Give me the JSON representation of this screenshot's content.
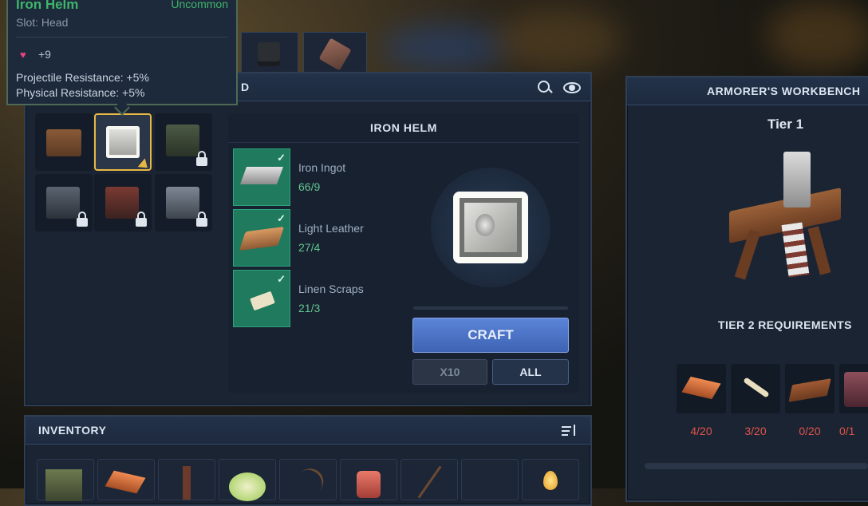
{
  "tooltip": {
    "name": "Iron Helm",
    "rarity": "Uncommon",
    "slot": "Slot: Head",
    "health_bonus": "+9",
    "stats": [
      "Projectile Resistance: +5%",
      "Physical Resistance: +5%"
    ]
  },
  "crafting": {
    "header_fragment": "D",
    "item_title": "IRON HELM",
    "materials": [
      {
        "name": "Iron Ingot",
        "count": "66/9"
      },
      {
        "name": "Light Leather",
        "count": "27/4"
      },
      {
        "name": "Linen Scraps",
        "count": "21/3"
      }
    ],
    "craft_label": "CRAFT",
    "x10_label": "X10",
    "all_label": "ALL"
  },
  "workbench": {
    "title": "ARMORER'S WORKBENCH",
    "tier": "Tier 1",
    "requirements_title": "TIER 2 REQUIREMENTS",
    "requirements": [
      {
        "icon": "copper-ingot-icon",
        "count": "4/20"
      },
      {
        "icon": "bone-icon",
        "count": "3/20"
      },
      {
        "icon": "planks-icon",
        "count": "0/20"
      },
      {
        "icon": "crate-icon",
        "count": "0/1"
      }
    ]
  },
  "inventory": {
    "title": "INVENTORY"
  },
  "colors": {
    "uncommon": "#3fb56b",
    "health": "#e6457a",
    "missing": "#e0534a",
    "have": "#63c48f",
    "accent_select": "#e7b844"
  }
}
